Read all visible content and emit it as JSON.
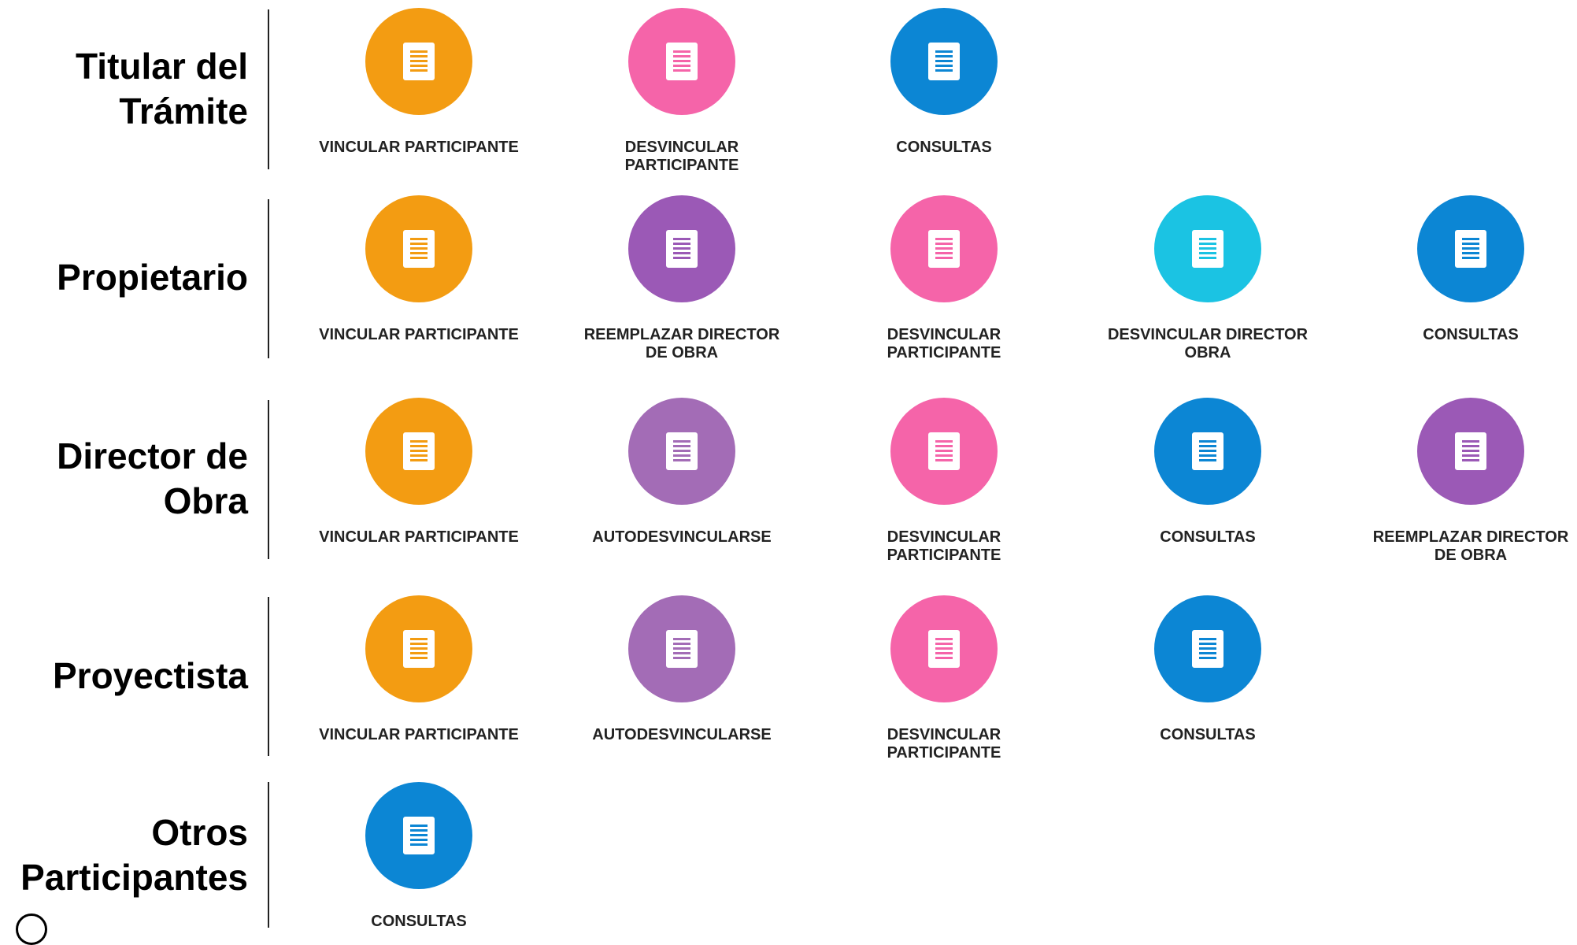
{
  "colors": {
    "orange": "#F39C12",
    "pink": "#F564A9",
    "blue": "#0C86D4",
    "purple": "#9B59B6",
    "light_purple": "#A36CB6",
    "cyan": "#1BC3E3"
  },
  "icon": "document-icon",
  "rows": [
    {
      "role": "Titular del Trámite",
      "actions": [
        {
          "label": "VINCULAR PARTICIPANTE",
          "color": "#F39C12"
        },
        {
          "label": "DESVINCULAR PARTICIPANTE",
          "color": "#F564A9"
        },
        {
          "label": "CONSULTAS",
          "color": "#0C86D4"
        }
      ]
    },
    {
      "role": "Propietario",
      "actions": [
        {
          "label": "VINCULAR PARTICIPANTE",
          "color": "#F39C12"
        },
        {
          "label": "REEMPLAZAR DIRECTOR DE OBRA",
          "color": "#9B59B6"
        },
        {
          "label": "DESVINCULAR PARTICIPANTE",
          "color": "#F564A9"
        },
        {
          "label": "DESVINCULAR DIRECTOR OBRA",
          "color": "#1BC3E3"
        },
        {
          "label": "CONSULTAS",
          "color": "#0C86D4"
        }
      ]
    },
    {
      "role": "Director de Obra",
      "actions": [
        {
          "label": "VINCULAR PARTICIPANTE",
          "color": "#F39C12"
        },
        {
          "label": "AUTODESVINCULARSE",
          "color": "#A36CB6"
        },
        {
          "label": "DESVINCULAR PARTICIPANTE",
          "color": "#F564A9"
        },
        {
          "label": "CONSULTAS",
          "color": "#0C86D4"
        },
        {
          "label": "REEMPLAZAR DIRECTOR DE OBRA",
          "color": "#9B59B6"
        }
      ]
    },
    {
      "role": "Proyectista",
      "actions": [
        {
          "label": "VINCULAR PARTICIPANTE",
          "color": "#F39C12"
        },
        {
          "label": "AUTODESVINCULARSE",
          "color": "#A36CB6"
        },
        {
          "label": "DESVINCULAR PARTICIPANTE",
          "color": "#F564A9"
        },
        {
          "label": "CONSULTAS",
          "color": "#0C86D4"
        }
      ]
    },
    {
      "role": "Otros Participantes",
      "actions": [
        {
          "label": "CONSULTAS",
          "color": "#0C86D4"
        }
      ]
    }
  ]
}
